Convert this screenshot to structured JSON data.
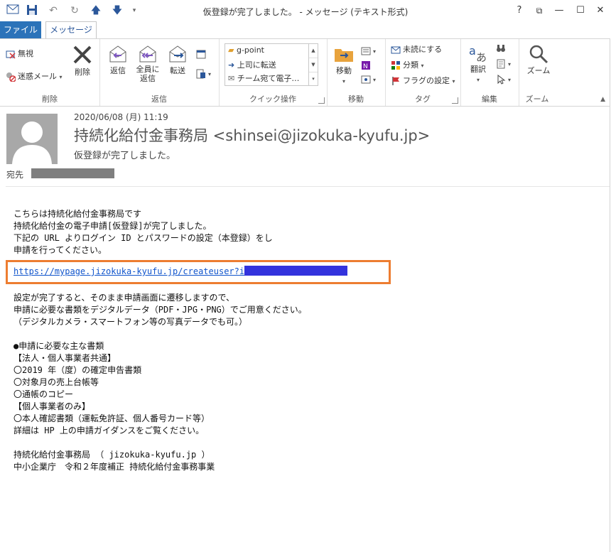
{
  "window": {
    "title": "仮登録が完了しました。 - メッセージ (テキスト形式)",
    "help": "?",
    "restore": "⧉",
    "minimize": "—",
    "maximize": "☐",
    "close": "✕"
  },
  "tabs": {
    "file": "ファイル",
    "message": "メッセージ"
  },
  "ribbon": {
    "delete_group": {
      "ignore": "無視",
      "junk": "迷惑メール",
      "delete": "削除",
      "label": "削除"
    },
    "respond_group": {
      "reply": "返信",
      "reply_all_1": "全員に",
      "reply_all_2": "返信",
      "forward": "転送",
      "label": "返信"
    },
    "quick_steps": {
      "item1": "g-point",
      "item2": "上司に転送",
      "item3": "チーム宛て電子…",
      "label": "クイック操作"
    },
    "move_group": {
      "move": "移動",
      "label": "移動"
    },
    "tags_group": {
      "unread": "未読にする",
      "categorize": "分類",
      "followup": "フラグの設定",
      "label": "タグ"
    },
    "editing_group": {
      "translate": "翻訳",
      "label": "編集"
    },
    "zoom_group": {
      "zoom": "ズーム",
      "label": "ズーム"
    }
  },
  "header": {
    "date": "2020/06/08 (月) 11:19",
    "sender": "持続化給付金事務局 <shinsei@jizokuka-kyufu.jp>",
    "subject": "仮登録が完了しました。",
    "to_label": "宛先"
  },
  "body": {
    "l1": "こちらは持続化給付金事務局です",
    "l2": "持続化給付金の電子申請[仮登録]が完了しました。",
    "l3": "下記の URL よりログイン ID とパスワードの設定（本登録）をし",
    "l4": "申請を行ってください。",
    "link": "https://mypage.jizokuka-kyufu.jp/createuser?id=",
    "l5": "設定が完了すると、そのまま申請画面に遷移しますので、",
    "l6": "申請に必要な書類をデジタルデータ（PDF・JPG・PNG）でご用意ください。",
    "l7": "（デジタルカメラ・スマートフォン等の写真データでも可。）",
    "l8": "●申請に必要な主な書類",
    "l9": "【法人・個人事業者共通】",
    "l10": "〇2019 年（度）の確定申告書類",
    "l11": "〇対象月の売上台帳等",
    "l12": "〇通帳のコピー",
    "l13": "【個人事業者のみ】",
    "l14": "〇本人確認書類（運転免許証、個人番号カード等）",
    "l15": "詳細は HP 上の申請ガイダンスをご覧ください。",
    "l16": "持続化給付金事務局 （ jizokuka-kyufu.jp ）",
    "l17": "中小企業庁　令和２年度補正 持続化給付金事務事業"
  },
  "colors": {
    "accent": "#2b73b9",
    "highlight": "#ed7d31",
    "link": "#1155cc"
  }
}
